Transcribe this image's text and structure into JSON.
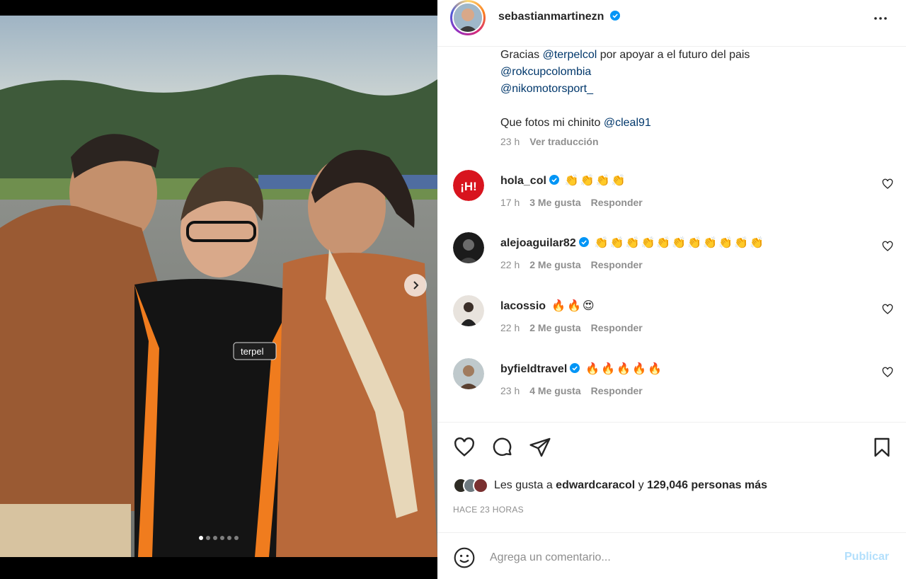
{
  "post": {
    "username": "sebastianmartinezn",
    "verified": true,
    "more_icon": "more-horizontal-icon",
    "carousel": {
      "slides": 6,
      "active": 1
    }
  },
  "caption": {
    "line1_prefix": "Gracias ",
    "line1_mention": "@terpelcol",
    "line1_suffix": " por apoyar a el futuro del pais",
    "mention2": "@rokcupcolombia",
    "mention3": "@nikomotorsport_",
    "line4_prefix": "Que fotos mi chinito ",
    "line4_mention": "@cleal91",
    "time": "23 h",
    "translate": "Ver traducción"
  },
  "comments": [
    {
      "user": "hola_col",
      "verified": true,
      "text": "👏👏👏👏",
      "time": "17 h",
      "likes": "3 Me gusta",
      "reply": "Responder"
    },
    {
      "user": "alejoaguilar82",
      "verified": true,
      "text": "👏👏👏👏👏👏👏👏👏👏👏",
      "time": "22 h",
      "likes": "2 Me gusta",
      "reply": "Responder"
    },
    {
      "user": "lacossio",
      "verified": false,
      "text": "🔥🔥😍",
      "time": "22 h",
      "likes": "2 Me gusta",
      "reply": "Responder"
    },
    {
      "user": "byfieldtravel",
      "verified": true,
      "text": "🔥🔥🔥🔥🔥",
      "time": "23 h",
      "likes": "4 Me gusta",
      "reply": "Responder"
    }
  ],
  "likes": {
    "prefix": "Les gusta a ",
    "user": "edwardcaracol",
    "middle": " y ",
    "count": "129,046 personas más"
  },
  "time_ago": "HACE 23 HORAS",
  "comment_box": {
    "placeholder": "Agrega un comentario...",
    "publish": "Publicar"
  },
  "colors": {
    "verified": "#0095f6",
    "mention": "#00376b",
    "publish_disabled": "#b2dffc",
    "muted": "#8e8e8e"
  }
}
